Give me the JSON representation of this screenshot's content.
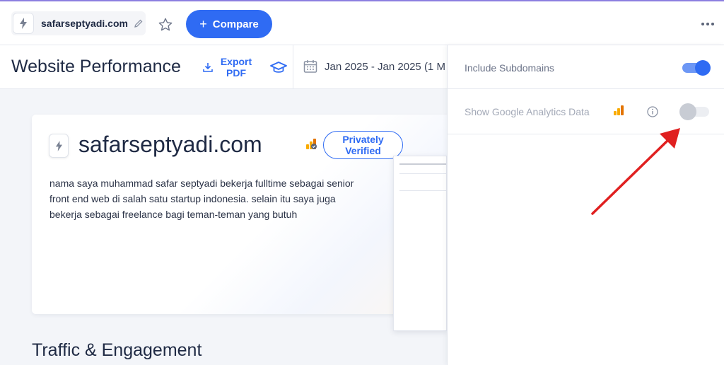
{
  "topbar": {
    "domain": "safarseptyadi.com",
    "compare_label": "Compare",
    "compare_plus": "+"
  },
  "subheader": {
    "title": "Website Performance",
    "export_label": "Export PDF",
    "date_range": "Jan 2025 - Jan 2025 (1 M"
  },
  "card": {
    "domain": "safarseptyadi.com",
    "verified_label": "Privately Verified",
    "description": "nama saya muhammad safar septyadi bekerja fulltime sebagai senior front end web di salah satu startup indonesia. selain itu saya juga bekerja sebagai freelance bagi teman-teman yang butuh"
  },
  "section": {
    "title": "Traffic & Engagement"
  },
  "panel": {
    "include_subdomains_label": "Include Subdomains",
    "include_subdomains_on": true,
    "show_ga_label": "Show Google Analytics Data",
    "show_ga_on": false
  },
  "colors": {
    "accent": "#2f6bf3",
    "arrow": "#e02020",
    "ga_orange": "#f9ab00"
  }
}
